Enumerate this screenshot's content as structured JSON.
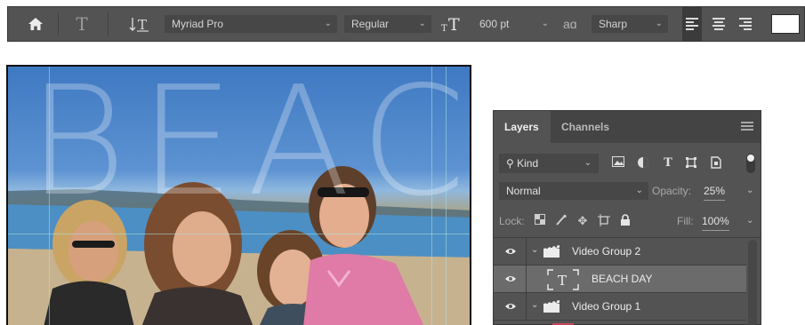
{
  "options_bar": {
    "home_icon": "home-icon",
    "type_tool_icon": "type-tool-icon",
    "text_orientation_icon": "text-orientation-icon",
    "font_family": "Myriad Pro",
    "font_style": "Regular",
    "font_size_icon": "font-size-icon",
    "font_size": "600 pt",
    "antialias_icon_glyph": "aɑ",
    "antialias": "Sharp",
    "align_icons": [
      "align-left-icon",
      "align-center-icon",
      "align-right-icon"
    ],
    "text_color": "#ffffff"
  },
  "canvas": {
    "overlay_text": "BEAC"
  },
  "layers_panel": {
    "tabs": [
      {
        "label": "Layers",
        "active": true
      },
      {
        "label": "Channels",
        "active": false
      }
    ],
    "filter_kind": "Kind",
    "blend_mode": "Normal",
    "opacity_label": "Opacity:",
    "opacity_value": "25%",
    "lock_label": "Lock:",
    "fill_label": "Fill:",
    "fill_value": "100%",
    "layers": [
      {
        "name": "Video Group 2",
        "type": "group",
        "visible": true,
        "selected": false
      },
      {
        "name": "BEACH DAY",
        "type": "text",
        "thumb_glyph": "T",
        "visible": true,
        "selected": true
      },
      {
        "name": "Video Group 1",
        "type": "group",
        "visible": true,
        "selected": false
      }
    ]
  },
  "colors": {
    "panel_bg": "#535353",
    "selected_row": "#6b6b6b",
    "accent_red": "#c9455a"
  }
}
